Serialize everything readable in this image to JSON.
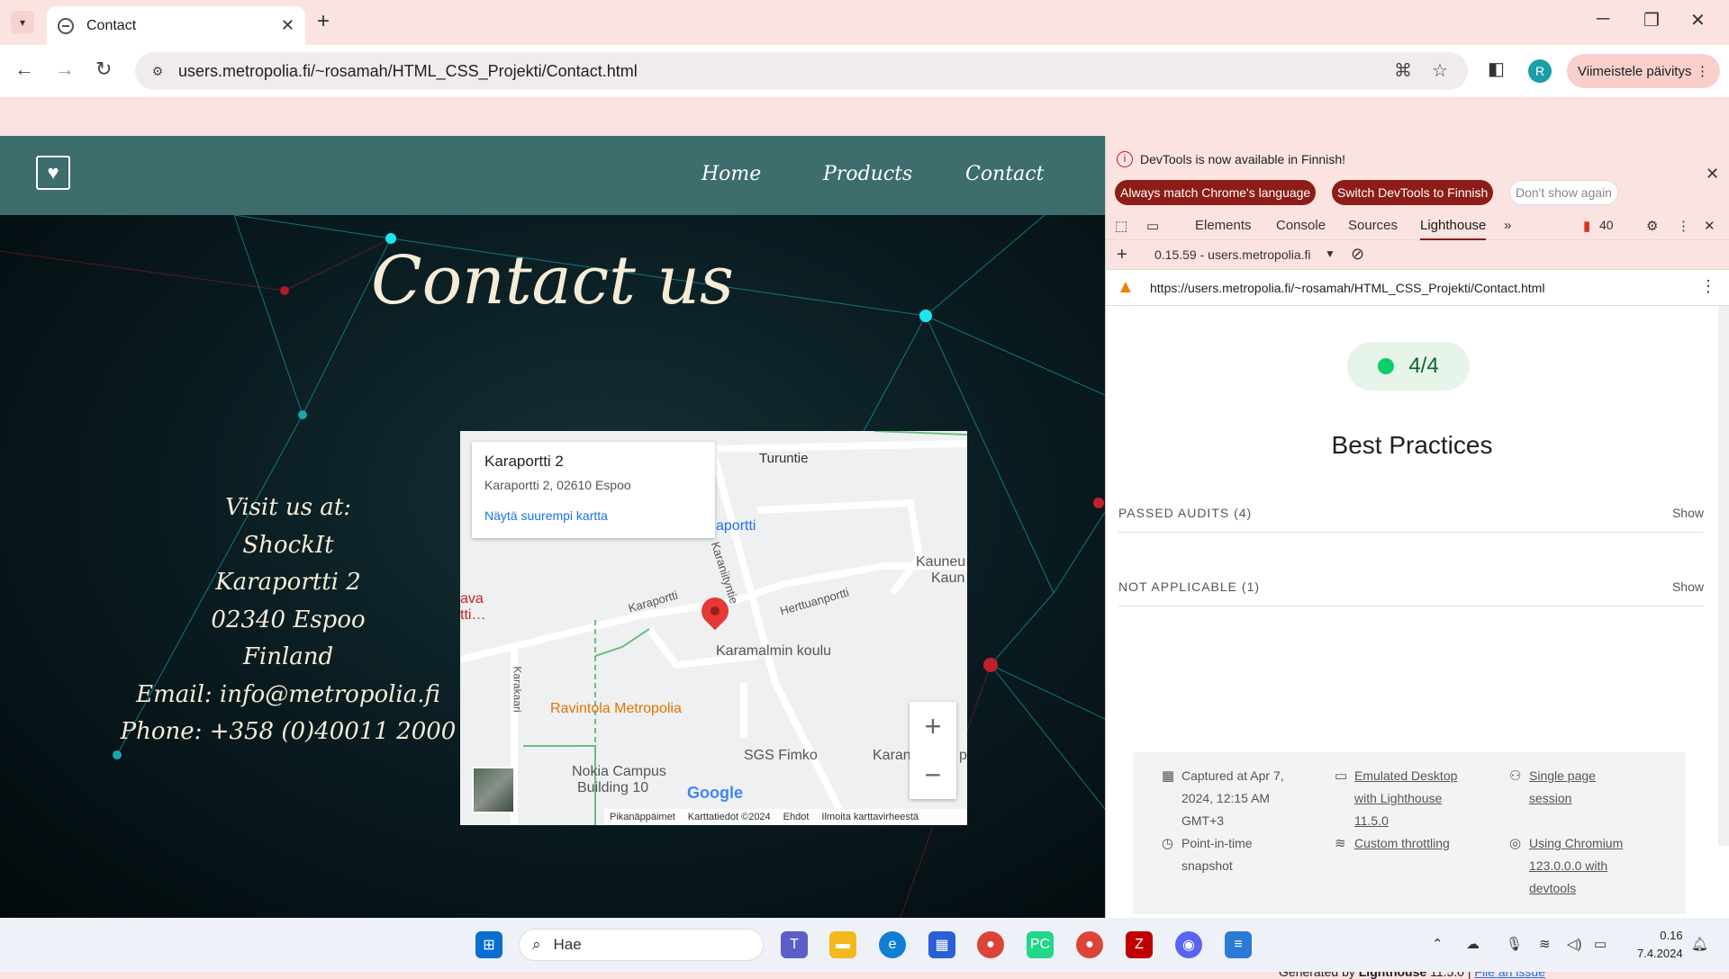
{
  "browser": {
    "tab_title": "Contact",
    "url": "users.metropolia.fi/~rosamah/HTML_CSS_Projekti/Contact.html",
    "profile_initial": "R",
    "update_label": "Viimeistele päivitys"
  },
  "site": {
    "nav": [
      "Home",
      "Products",
      "Contact"
    ],
    "heading": "Contact us",
    "visit_lines": [
      "Visit us at:",
      "ShockIt",
      "Karaportti 2",
      "02340 Espoo",
      "Finland",
      "Email: info@metropolia.fi",
      "Phone: +358 (0)40011 2000"
    ]
  },
  "map": {
    "place_title": "Karaportti 2",
    "place_address": "Karaportti 2, 02610 Espoo",
    "bigger_map_link": "Näytä suurempi kartta",
    "labels": {
      "turuntie": "Turuntie",
      "karaportti_store": "aportti",
      "kauneu": "Kauneu",
      "kaun": "Kaun",
      "ava": "ava",
      "tti": "tti…",
      "karaportti_road": "Karaportti",
      "karanliityntie": "Karaniityntie",
      "herttuanporrti": "Herttuanportti",
      "karamalmin_koulu": "Karamalmin koulu",
      "ravintola": "Ravintola Metropolia",
      "sgs": "SGS Fimko",
      "karan": "Karan",
      "nokia": "Nokia Campus",
      "building": "Building 10",
      "karakaari": "Karakaari",
      "p": "p"
    },
    "zoom_in": "+",
    "zoom_out": "−",
    "google_logo": "Google",
    "footer": [
      "Pikanäppäimet",
      "Karttatiedot ©2024",
      "Ehdot",
      "Ilmoita karttavirheestä"
    ]
  },
  "devtools": {
    "banner_message": "DevTools is now available in Finnish!",
    "btn_match": "Always match Chrome's language",
    "btn_switch": "Switch DevTools to Finnish",
    "btn_dont_show": "Don't show again",
    "tabs": [
      "Elements",
      "Console",
      "Sources",
      "Lighthouse"
    ],
    "issues_count": "40",
    "report_selector": "0.15.59 - users.metropolia.fi",
    "report_url": "https://users.metropolia.fi/~rosamah/HTML_CSS_Projekti/Contact.html",
    "score": "4/4",
    "category": "Best Practices",
    "passed_audits": "PASSED AUDITS (4)",
    "not_applicable": "NOT APPLICABLE (1)",
    "show": "Show",
    "env": {
      "captured": [
        "Captured at Apr 7,",
        "2024, 12:15 AM",
        "GMT+3"
      ],
      "emulated": [
        "Emulated Desktop",
        "with Lighthouse",
        "11.5.0"
      ],
      "session": [
        "Single page",
        "session"
      ],
      "snapshot": [
        "Point-in-time",
        "snapshot"
      ],
      "throttling": [
        "Custom throttling"
      ],
      "chromium": [
        "Using Chromium",
        "123.0.0.0 with",
        "devtools"
      ]
    },
    "generated_by": "Generated by",
    "lighthouse_name": "Lighthouse",
    "lighthouse_version": "11.5.0 |",
    "file_issue": "File an issue"
  },
  "taskbar": {
    "search_placeholder": "Hae",
    "time": "0.16",
    "date": "7.4.2024"
  },
  "colors": {
    "header_teal": "#3d6d6c",
    "chrome_pink": "#fbe3e1",
    "devtools_accent": "#8c1d18",
    "score_green": "#0cce6b"
  }
}
